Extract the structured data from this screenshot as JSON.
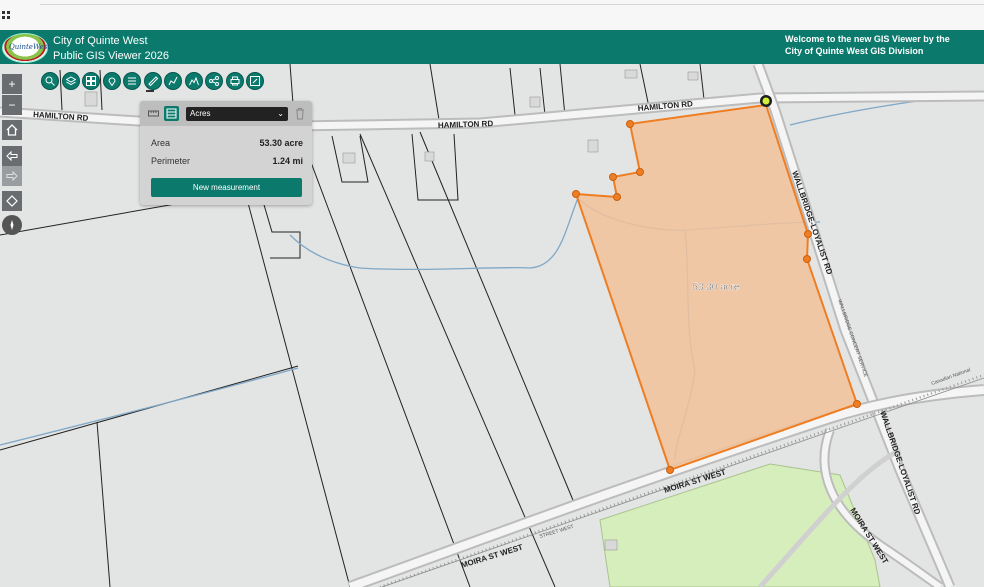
{
  "header": {
    "title_line1": "City of Quinte West",
    "title_line2": "Public GIS Viewer 2026",
    "welcome_line1": "Welcome to the new GIS Viewer by the",
    "welcome_line2": "City of Quinte West GIS Division",
    "logo_text": "QuinteWest"
  },
  "toolbar": {
    "tools": [
      "search-icon",
      "layers-icon",
      "basemap-icon",
      "location-icon",
      "list-icon",
      "measure-icon",
      "draw-icon",
      "elevation-icon",
      "share-icon",
      "print-icon",
      "edit-icon"
    ],
    "active_tool": "measure-icon",
    "color": "#0b7a6c"
  },
  "nav": {
    "zoom_in": "+",
    "zoom_out": "−"
  },
  "measure_panel": {
    "unit_selected": "Acres",
    "area_label": "Area",
    "area_value": "53.30 acre",
    "perimeter_label": "Perimeter",
    "perimeter_value": "1.24 mi",
    "new_button": "New measurement"
  },
  "map": {
    "polygon_label": "53.30 acre",
    "polygon_fill": "#f2c29a",
    "polygon_stroke": "#ef7d22",
    "park_fill": "#d6eebc",
    "labels": {
      "hamilton_left": "HAMILTON RD",
      "hamilton_mid": "HAMILTON RD",
      "hamilton_right": "HAMILTON RD",
      "wallbridge_upper": "WALLBRIDGE-LOYALIST RD",
      "wallbridge_lower": "WALLBRIDGE-LOYALIST RD",
      "moira_center": "MOIRA ST WEST",
      "moira_left": "MOIRA ST WEST",
      "moira_right": "MOIRA ST WEST",
      "moira_small": "STREET WEST",
      "rail_upper": "WALLBRIDGE CONCERT SERVICE",
      "rail_lower": "Canadian National"
    }
  }
}
